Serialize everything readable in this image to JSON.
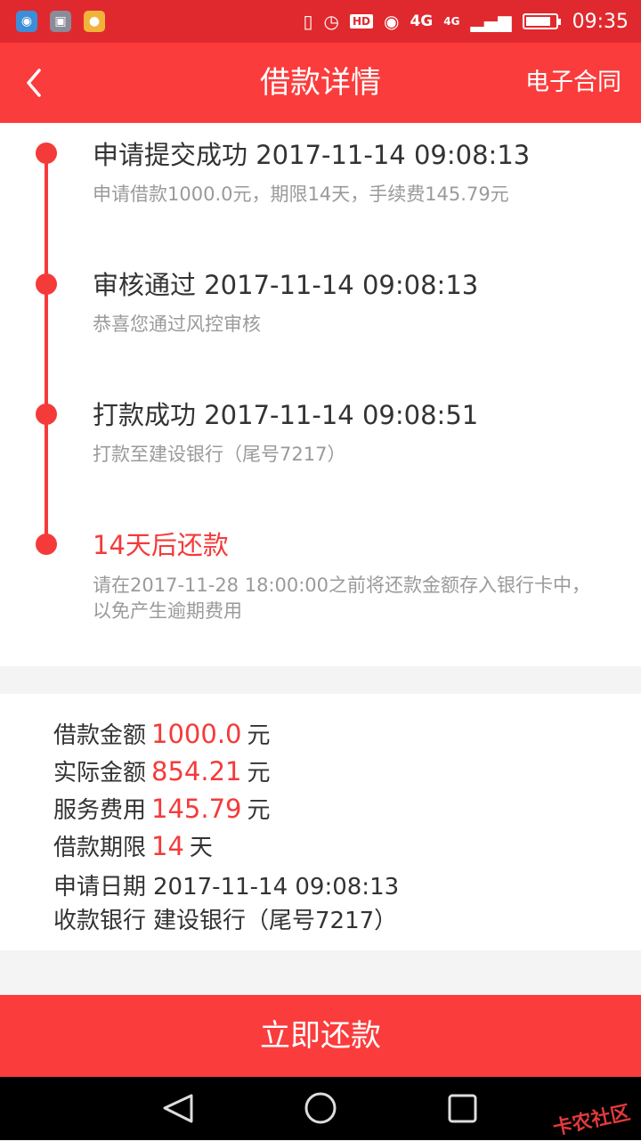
{
  "status_bar": {
    "time": "09:35",
    "hd": "HD",
    "network": "4G",
    "network2": "4G",
    "battery_level": 0.85,
    "icons": [
      "location-app-icon",
      "gallery-app-icon",
      "wallet-app-icon",
      "vibrate-icon",
      "alarm-icon",
      "eye-icon",
      "signal-icon",
      "battery-icon"
    ]
  },
  "nav": {
    "title": "借款详情",
    "right_action": "电子合同",
    "back_icon": "chevron-left-icon"
  },
  "timeline": [
    {
      "title": "申请提交成功 2017-11-14 09:08:13",
      "desc": "申请借款1000.0元，期限14天，手续费145.79元"
    },
    {
      "title": "审核通过 2017-11-14 09:08:13",
      "desc": "恭喜您通过风控审核"
    },
    {
      "title": "打款成功 2017-11-14 09:08:51",
      "desc": "打款至建设银行（尾号7217）"
    },
    {
      "title": "14天后还款",
      "desc_line1": "请在2017-11-28 18:00:00之前将还款金额存入银行卡中，",
      "desc_line2": "以免产生逾期费用"
    }
  ],
  "details": {
    "loan_amount": {
      "label": "借款金额",
      "value": "1000.0",
      "unit": "元"
    },
    "actual_amount": {
      "label": "实际金额",
      "value": "854.21",
      "unit": "元"
    },
    "service_fee": {
      "label": "服务费用",
      "value": "145.79",
      "unit": "元"
    },
    "loan_term": {
      "label": "借款期限",
      "value": "14",
      "unit": "天"
    },
    "apply_date": {
      "label": "申请日期",
      "value": "2017-11-14 09:08:13"
    },
    "bank": {
      "label": "收款银行",
      "value": "建设银行（尾号7217）"
    }
  },
  "repay_button": "立即还款",
  "watermark": "卡农社区",
  "colors": {
    "accent": "#fb3c3c",
    "status_bar": "#e0292e",
    "timeline": "#f53a3a"
  }
}
